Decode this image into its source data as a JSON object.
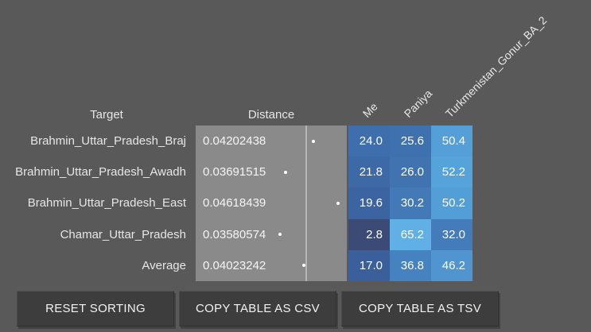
{
  "theme": {
    "background": "#595959",
    "distance_panel": "#8a8a8a",
    "scale_gridline": "#b5b5b5",
    "dot": "#ffffff",
    "button_background": "#3d3d3d",
    "button_text": "#f2f2f2",
    "text": "#e6e6e6"
  },
  "table": {
    "headers": {
      "target": "Target",
      "distance": "Distance"
    },
    "pop_headers": [
      "Me",
      "Paniya",
      "Turkmenistan_Gonur_BA_2"
    ],
    "rows": [
      {
        "target": "Brahmin_Uttar_Pradesh_Braj",
        "distance": "0.04202438",
        "dot_left": "76.8%",
        "values": [
          "24.0",
          "25.6",
          "50.4"
        ],
        "colors": [
          "#3e6eac",
          "#4071af",
          "#549fd7"
        ]
      },
      {
        "target": "Brahmin_Uttar_Pradesh_Awadh",
        "distance": "0.03691515",
        "dot_left": "58.4%",
        "values": [
          "21.8",
          "26.0",
          "52.2"
        ],
        "colors": [
          "#3d69a7",
          "#4173b1",
          "#56a3da"
        ]
      },
      {
        "target": "Brahmin_Uttar_Pradesh_East",
        "distance": "0.04618439",
        "dot_left": "93.2%",
        "values": [
          "19.6",
          "30.2",
          "50.2"
        ],
        "colors": [
          "#3c64a1",
          "#4379b7",
          "#539ed6"
        ]
      },
      {
        "target": "Chamar_Uttar_Pradesh",
        "distance": "0.03580574",
        "dot_left": "54.7%",
        "values": [
          "2.8",
          "65.2",
          "32.0"
        ],
        "colors": [
          "#3c4b76",
          "#60afe5",
          "#447cba"
        ]
      },
      {
        "target": "Average",
        "distance": "0.04023242",
        "dot_left": "70.5%",
        "values": [
          "17.0",
          "36.8",
          "46.2"
        ],
        "colors": [
          "#3b5f9a",
          "#4682c0",
          "#5095cf"
        ]
      }
    ]
  },
  "actions": [
    {
      "label": "RESET SORTING"
    },
    {
      "label": "COPY TABLE AS CSV"
    },
    {
      "label": "COPY TABLE AS TSV"
    }
  ]
}
